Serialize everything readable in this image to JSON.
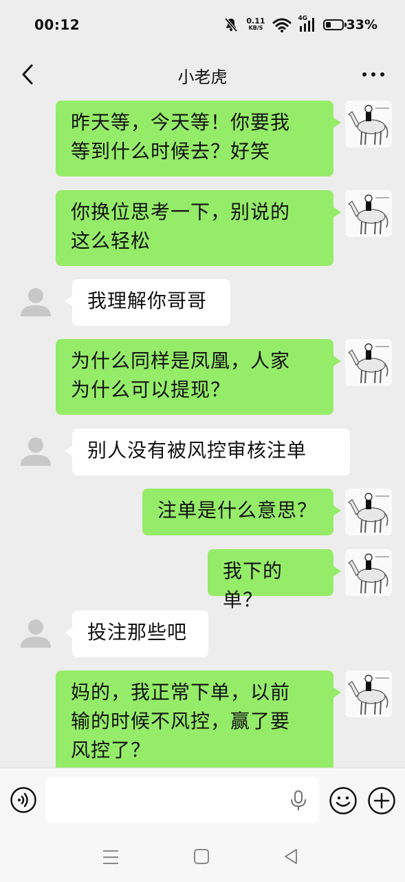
{
  "status_bar": {
    "time": "00:12",
    "net_speed_value": "0.11",
    "net_speed_unit": "KB/S",
    "network": "4G",
    "battery_percent": "33%",
    "battery_level": 0.33,
    "icons": [
      "mute-bell-icon",
      "wifi-icon",
      "signal-icon",
      "battery-icon"
    ]
  },
  "header": {
    "title": "小老虎",
    "back_icon": "chevron-left-icon",
    "more_icon": "more-dots-icon"
  },
  "messages": [
    {
      "side": "sent",
      "text": "昨天等，今天等！你要我\n等到什么时候去？好笑"
    },
    {
      "side": "sent",
      "text": "你换位思考一下，别说的\n这么轻松"
    },
    {
      "side": "recv",
      "text": "我理解你哥哥"
    },
    {
      "side": "sent",
      "text": "为什么同样是凤凰，人家\n为什么可以提现？"
    },
    {
      "side": "recv",
      "text": "别人没有被风控审核注单"
    },
    {
      "side": "sent",
      "text": "注单是什么意思？"
    },
    {
      "side": "sent",
      "text": "我下的单？"
    },
    {
      "side": "recv",
      "text": "投注那些吧"
    },
    {
      "side": "sent",
      "text": "妈的，我正常下单，以前\n输的时候不风控，赢了要\n风控了？"
    }
  ],
  "input_bar": {
    "placeholder": "",
    "icons": [
      "voice-icon",
      "mic-icon",
      "emoji-icon",
      "plus-icon"
    ]
  },
  "nav_bar": {
    "icons": [
      "menu-icon",
      "home-icon",
      "back-triangle-icon"
    ]
  },
  "colors": {
    "background": "#ededed",
    "sent_bubble": "#95ec69",
    "received_bubble": "#ffffff",
    "avatar_placeholder": "#c8c8c8"
  }
}
